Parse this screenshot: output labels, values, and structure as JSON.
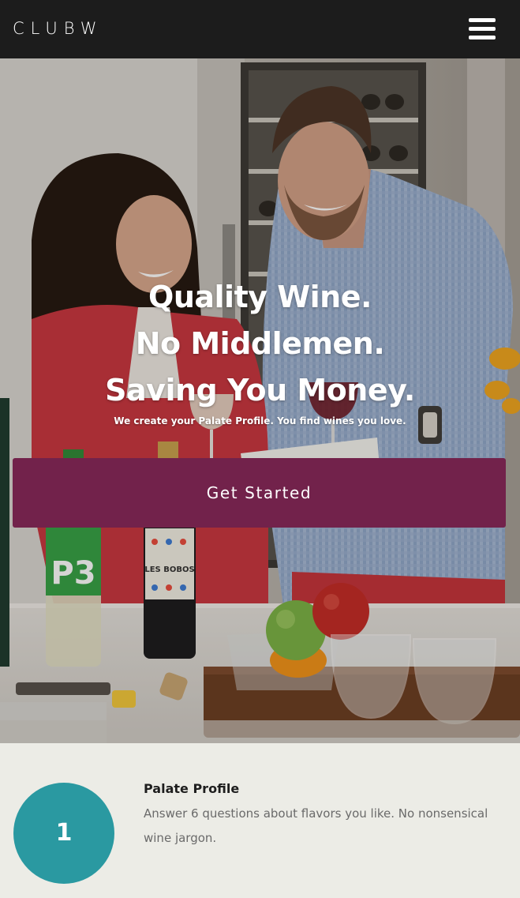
{
  "header": {
    "logo_text": "CLUBW",
    "menu_icon": "hamburger-menu-icon"
  },
  "hero": {
    "headline_lines": [
      "Quality Wine.",
      "No Middlemen.",
      "Saving You Money."
    ],
    "subheadline": "We create your Palate Profile. You find wines you love.",
    "cta_label": "Get Started",
    "photo": "couple-tasting-wine-in-kitchen",
    "bottle_labels": [
      "P3",
      "LES BOBOS"
    ]
  },
  "steps": [
    {
      "number": "1",
      "title": "Palate Profile",
      "description": "Answer 6 questions about flavors you like. No nonsensical wine jargon."
    }
  ],
  "colors": {
    "header_bg": "#1c1c1c",
    "cta_bg": "#72224b",
    "step_circle": "#2a99a1",
    "section_bg": "#ecece6"
  }
}
